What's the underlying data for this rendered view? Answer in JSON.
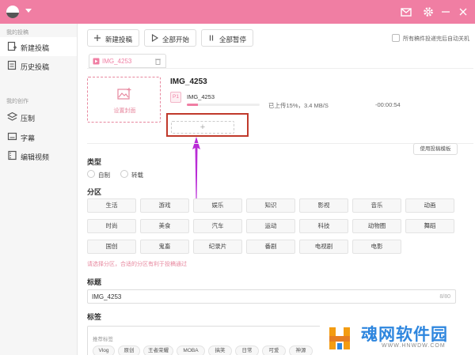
{
  "titlebar": {
    "icons": [
      "logo",
      "chevron-down-icon",
      "mail-icon",
      "gear-icon",
      "minimize-icon",
      "close-icon"
    ],
    "accent": "#f07ea3"
  },
  "sidebar": {
    "group1": "我的投稿",
    "items1": [
      {
        "label": "新建投稿",
        "icon": "upload-icon",
        "active": true
      },
      {
        "label": "历史投稿",
        "icon": "history-icon",
        "active": false
      }
    ],
    "group2": "我的创作",
    "items2": [
      {
        "label": "压制",
        "icon": "layers-icon"
      },
      {
        "label": "字幕",
        "icon": "subtitle-icon"
      },
      {
        "label": "编辑视频",
        "icon": "film-icon"
      }
    ]
  },
  "toolbar": {
    "new_label": "新建投稿",
    "start_label": "全部开始",
    "pause_label": "全部暂停",
    "shutdown_label": "所有稿件投递完后自动关机"
  },
  "upload": {
    "tab_name": "IMG_4253",
    "video_title": "IMG_4253",
    "part_badge": "P1",
    "part_name": "IMG_4253",
    "progress_fraction": 0.15,
    "status": "已上传15%，3.4 MB/S",
    "eta": "-00:00:54",
    "cover_label": "设置封面",
    "add_symbol": "+",
    "template_button": "使用投稿模板"
  },
  "type_section": {
    "title": "类型",
    "options": [
      "自制",
      "转载"
    ]
  },
  "zone_section": {
    "title": "分区",
    "rows": [
      [
        "生活",
        "游戏",
        "娱乐",
        "知识",
        "影视",
        "音乐",
        "动画"
      ],
      [
        "时尚",
        "美食",
        "汽车",
        "运动",
        "科技",
        "动物圈",
        "舞蹈"
      ],
      [
        "国创",
        "鬼畜",
        "纪录片",
        "番剧",
        "电视剧",
        "电影"
      ]
    ],
    "hint": "请选择分区，合适的分区有利于投稿通过"
  },
  "title_section": {
    "title": "标题",
    "value": "IMG_4253",
    "count": "8/80"
  },
  "tag_section": {
    "title": "标签",
    "recommend_label": "推荐标签",
    "tags": [
      "Vlog",
      "原创",
      "王者荣耀",
      "MOBA",
      "搞笑",
      "日常",
      "可爱",
      "神源"
    ]
  },
  "watermark": {
    "brand": "魂网软件园",
    "url": "WWW.HNWDW.COM"
  }
}
